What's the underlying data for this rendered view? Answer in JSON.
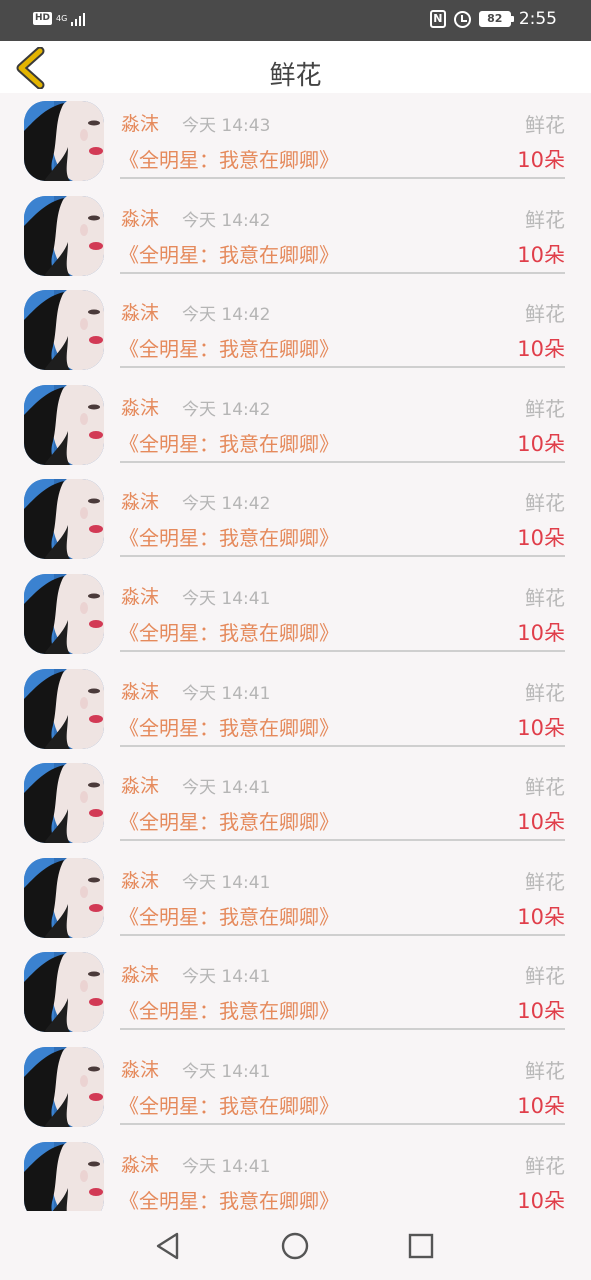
{
  "status_bar": {
    "hd": "HD",
    "network": "4G",
    "battery": "82",
    "time": "2:55",
    "icons": [
      "signal-icon",
      "nfc-icon",
      "alarm-icon",
      "battery-icon"
    ]
  },
  "header": {
    "title": "鲜花",
    "back_icon": "chevron-left-icon",
    "back_color": "#d8a800"
  },
  "colors": {
    "name": "#e58a5c",
    "time": "#b5b5b5",
    "count": "#e03e4a",
    "kind": "#b8b8b8"
  },
  "items": [
    {
      "name": "淼沫",
      "time": "今天 14:43",
      "type": "鲜花",
      "work": "《全明星：我意在卿卿》",
      "count": "10朵"
    },
    {
      "name": "淼沫",
      "time": "今天 14:42",
      "type": "鲜花",
      "work": "《全明星：我意在卿卿》",
      "count": "10朵"
    },
    {
      "name": "淼沫",
      "time": "今天 14:42",
      "type": "鲜花",
      "work": "《全明星：我意在卿卿》",
      "count": "10朵"
    },
    {
      "name": "淼沫",
      "time": "今天 14:42",
      "type": "鲜花",
      "work": "《全明星：我意在卿卿》",
      "count": "10朵"
    },
    {
      "name": "淼沫",
      "time": "今天 14:42",
      "type": "鲜花",
      "work": "《全明星：我意在卿卿》",
      "count": "10朵"
    },
    {
      "name": "淼沫",
      "time": "今天 14:41",
      "type": "鲜花",
      "work": "《全明星：我意在卿卿》",
      "count": "10朵"
    },
    {
      "name": "淼沫",
      "time": "今天 14:41",
      "type": "鲜花",
      "work": "《全明星：我意在卿卿》",
      "count": "10朵"
    },
    {
      "name": "淼沫",
      "time": "今天 14:41",
      "type": "鲜花",
      "work": "《全明星：我意在卿卿》",
      "count": "10朵"
    },
    {
      "name": "淼沫",
      "time": "今天 14:41",
      "type": "鲜花",
      "work": "《全明星：我意在卿卿》",
      "count": "10朵"
    },
    {
      "name": "淼沫",
      "time": "今天 14:41",
      "type": "鲜花",
      "work": "《全明星：我意在卿卿》",
      "count": "10朵"
    },
    {
      "name": "淼沫",
      "time": "今天 14:41",
      "type": "鲜花",
      "work": "《全明星：我意在卿卿》",
      "count": "10朵"
    },
    {
      "name": "淼沫",
      "time": "今天 14:41",
      "type": "鲜花",
      "work": "《全明星：我意在卿卿》",
      "count": "10朵"
    }
  ],
  "navbar": {
    "buttons": [
      "back-triangle-icon",
      "home-circle-icon",
      "recents-square-icon"
    ]
  }
}
